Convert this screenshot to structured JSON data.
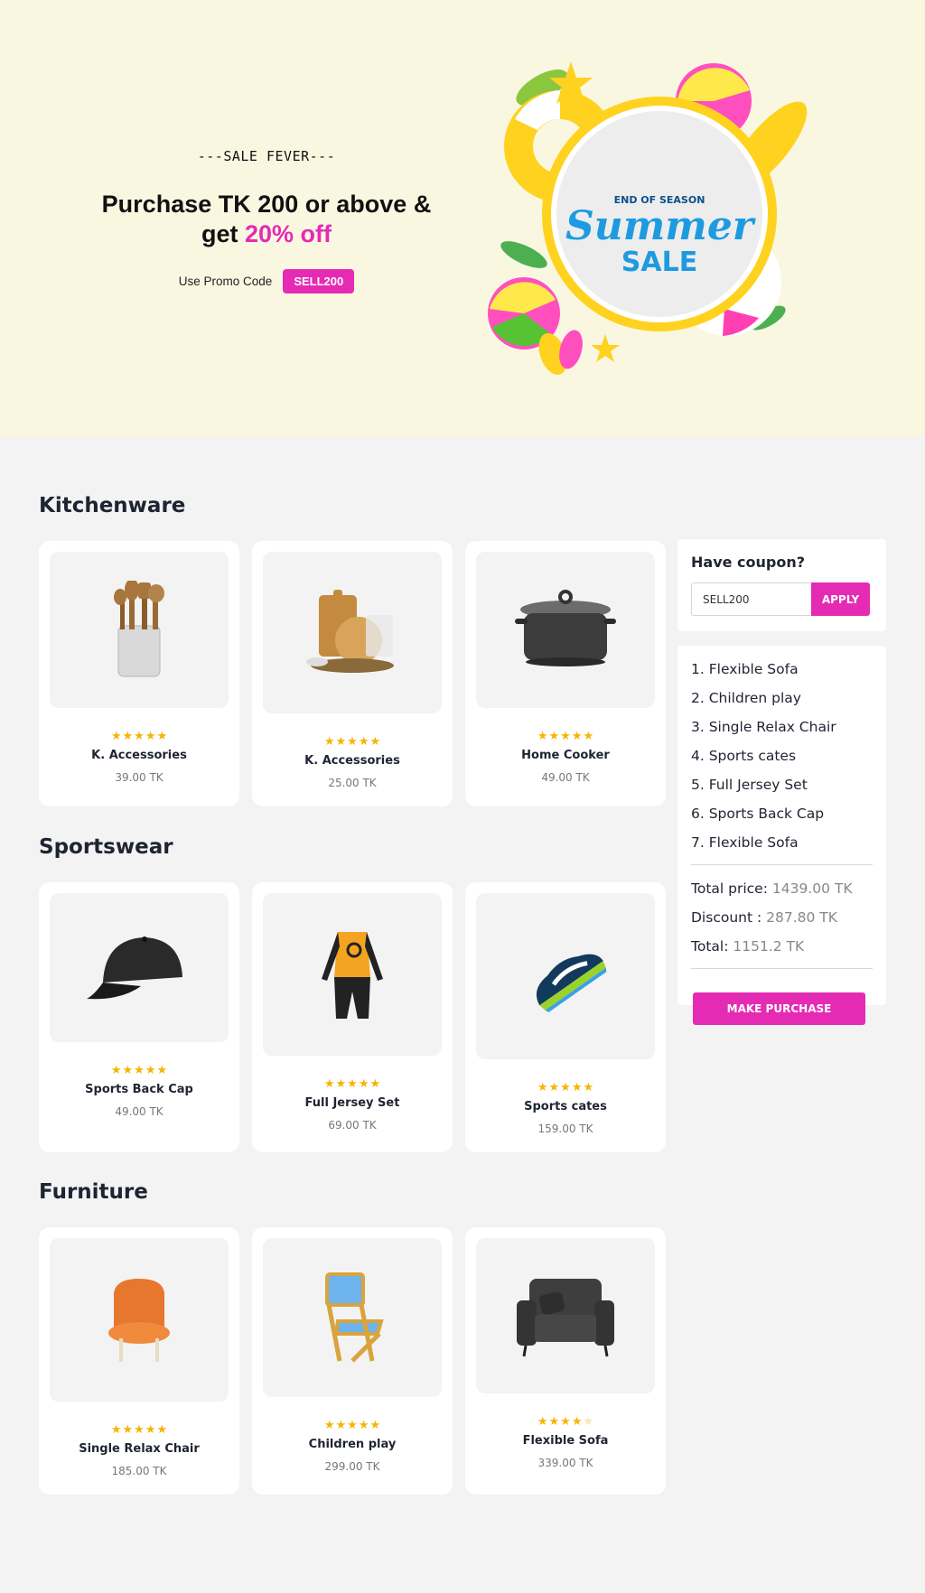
{
  "hero": {
    "eyebrow": "---SALE FEVER---",
    "headline_line1": "Purchase TK 200 or above &",
    "headline_get": "get ",
    "headline_accent": "20% off",
    "promo_label": "Use Promo Code",
    "promo_code": "SELL200",
    "banner_small": "END OF SEASON",
    "banner_script": "Summer",
    "banner_sale": "SALE"
  },
  "sections": {
    "kitchenware": {
      "title": "Kitchenware",
      "products": [
        {
          "name": "K. Accessories",
          "price": "39.00 TK",
          "rating": 5,
          "image": "kitchen-utensils-icon"
        },
        {
          "name": "K. Accessories",
          "price": "25.00 TK",
          "rating": 5,
          "image": "cutting-boards-icon"
        },
        {
          "name": "Home Cooker",
          "price": "49.00 TK",
          "rating": 5,
          "image": "cooking-pot-icon"
        }
      ]
    },
    "sportswear": {
      "title": "Sportswear",
      "products": [
        {
          "name": "Sports Back Cap",
          "price": "49.00 TK",
          "rating": 5,
          "image": "cap-icon"
        },
        {
          "name": "Full Jersey Set",
          "price": "69.00 TK",
          "rating": 5,
          "image": "jersey-icon"
        },
        {
          "name": "Sports cates",
          "price": "159.00 TK",
          "rating": 5,
          "image": "sneaker-icon"
        }
      ]
    },
    "furniture": {
      "title": "Furniture",
      "products": [
        {
          "name": "Single Relax Chair",
          "price": "185.00 TK",
          "rating": 5,
          "image": "armchair-icon"
        },
        {
          "name": "Children play",
          "price": "299.00 TK",
          "rating": 5,
          "image": "folding-chair-icon"
        },
        {
          "name": "Flexible Sofa",
          "price": "339.00 TK",
          "rating": 4,
          "image": "sofa-icon"
        }
      ]
    }
  },
  "coupon": {
    "title": "Have coupon?",
    "input_value": "SELL200",
    "apply_label": "APPLY"
  },
  "cart": {
    "items": [
      "1. Flexible Sofa",
      "2. Children play",
      "3. Single Relax Chair",
      "4. Sports cates",
      "5. Full Jersey Set",
      "6. Sports Back Cap",
      "7. Flexible Sofa"
    ],
    "total_price_label": "Total price:",
    "total_price_value": "1439.00 TK",
    "discount_label": "Discount :",
    "discount_value": "287.80 TK",
    "total_label": "Total:",
    "total_value": "1151.2 TK",
    "purchase_label": "MAKE PURCHASE"
  },
  "colors": {
    "accent": "#e52bb4",
    "star": "#f5b400",
    "hero_bg": "#faf7e1",
    "page_bg": "#f3f3f3"
  }
}
